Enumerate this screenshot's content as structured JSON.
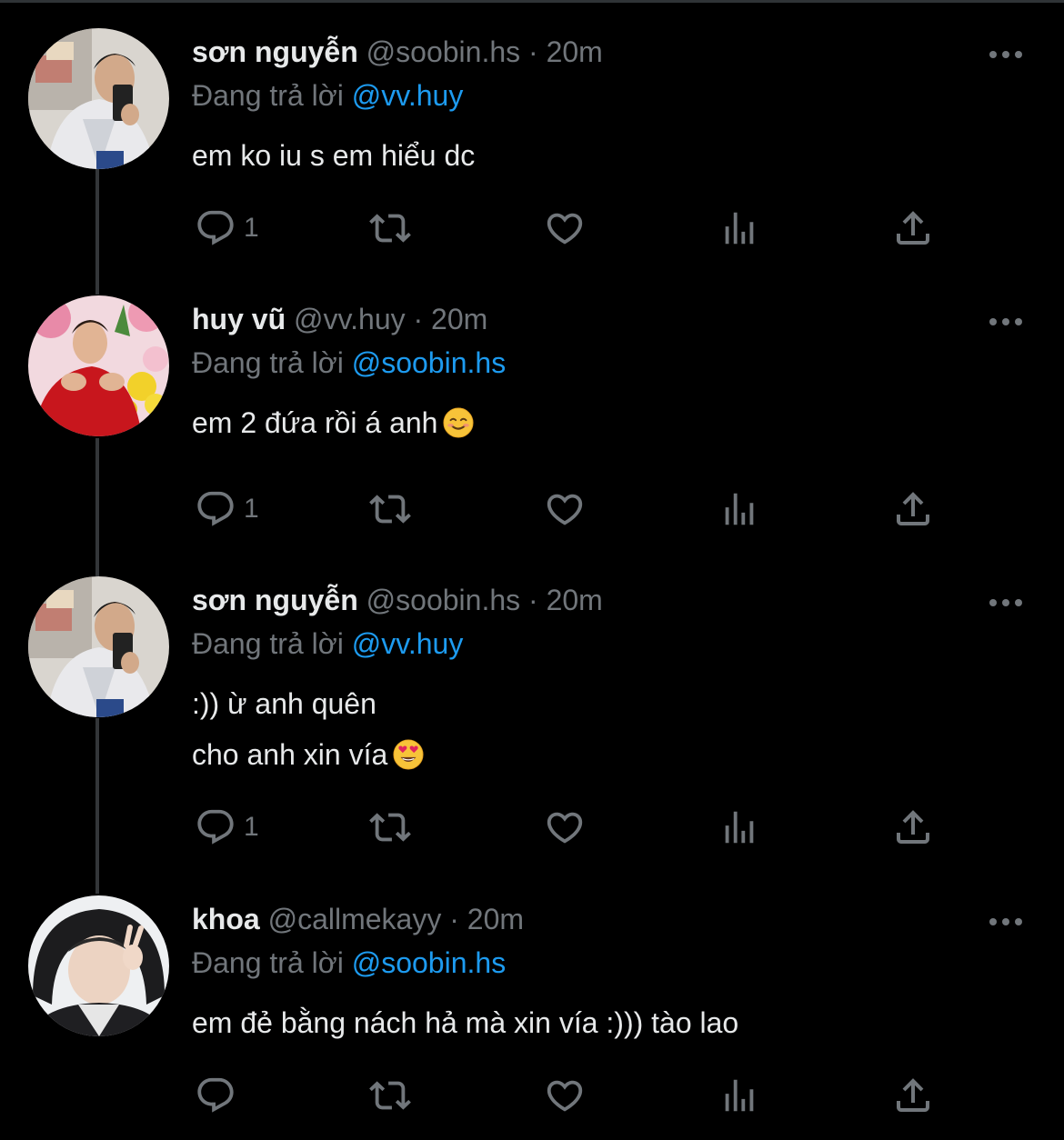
{
  "tweets": [
    {
      "name": "sơn nguyễn",
      "handle": "@soobin.hs",
      "separator": "·",
      "time": "20m",
      "reply_prefix": "Đang trả lời",
      "reply_mention": "@vv.huy",
      "body_lines": [
        "em ko iu s em hiểu dc"
      ],
      "emoji": "",
      "reply_count": "1",
      "avatar": "avatar-son"
    },
    {
      "name": "huy vũ",
      "handle": "@vv.huy",
      "separator": "·",
      "time": "20m",
      "reply_prefix": "Đang trả lời",
      "reply_mention": "@soobin.hs",
      "body_lines": [
        "em 2 đứa rồi á anh"
      ],
      "emoji": "smiling-face-emoji",
      "reply_count": "1",
      "avatar": "avatar-huy"
    },
    {
      "name": "sơn nguyễn",
      "handle": "@soobin.hs",
      "separator": "·",
      "time": "20m",
      "reply_prefix": "Đang trả lời",
      "reply_mention": "@vv.huy",
      "body_lines": [
        ":)) ừ anh quên",
        "cho anh xin vía"
      ],
      "emoji": "heart-eyes-emoji",
      "reply_count": "1",
      "avatar": "avatar-son"
    },
    {
      "name": "khoa",
      "handle": "@callmekayy",
      "separator": "·",
      "time": "20m",
      "reply_prefix": "Đang trả lời",
      "reply_mention": "@soobin.hs",
      "body_lines": [
        "em đẻ bằng nách hả mà xin vía :))) tào lao"
      ],
      "emoji": "",
      "reply_count": "",
      "avatar": "avatar-khoa"
    }
  ],
  "icons": {
    "reply": "comment-icon",
    "retweet": "retweet-icon",
    "like": "heart-icon",
    "views": "analytics-icon",
    "share": "share-icon",
    "more": "more-icon"
  },
  "colors": {
    "background": "#000000",
    "text": "#e7e9ea",
    "secondary": "#71767b",
    "link": "#1d9bf0",
    "thread_line": "#333639"
  }
}
